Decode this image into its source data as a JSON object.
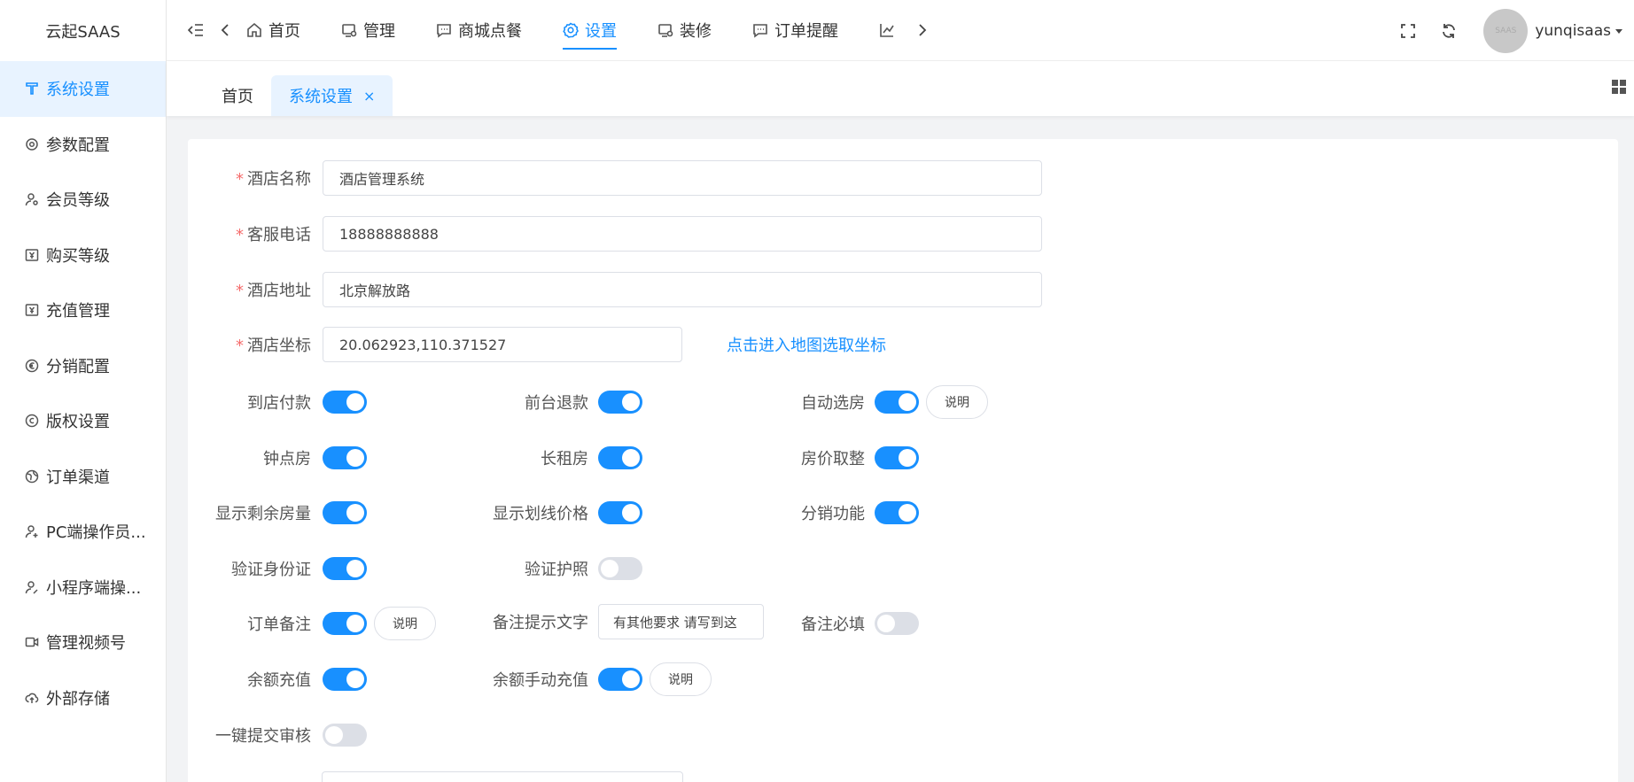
{
  "sidebar": {
    "brand": "云起SAAS",
    "items": [
      {
        "label": "系统设置",
        "icon": "tool-icon"
      },
      {
        "label": "参数配置",
        "icon": "gear-icon"
      },
      {
        "label": "会员等级",
        "icon": "user-icon"
      },
      {
        "label": "购买等级",
        "icon": "yen-icon"
      },
      {
        "label": "充值管理",
        "icon": "yen-icon"
      },
      {
        "label": "分销配置",
        "icon": "euro-icon"
      },
      {
        "label": "版权设置",
        "icon": "copyright-icon"
      },
      {
        "label": "订单渠道",
        "icon": "globe-icon"
      },
      {
        "label": "PC端操作员...",
        "icon": "user-add-icon"
      },
      {
        "label": "小程序端操...",
        "icon": "user-edit-icon"
      },
      {
        "label": "管理视频号",
        "icon": "video-icon"
      },
      {
        "label": "外部存储",
        "icon": "cloud-upload-icon"
      }
    ]
  },
  "header": {
    "nav": [
      {
        "label": "首页",
        "icon": "home-icon"
      },
      {
        "label": "管理",
        "icon": "monitor-gear-icon"
      },
      {
        "label": "商城点餐",
        "icon": "chat-icon"
      },
      {
        "label": "设置",
        "icon": "gear-icon"
      },
      {
        "label": "装修",
        "icon": "monitor-gear-icon"
      },
      {
        "label": "订单提醒",
        "icon": "chat-icon"
      }
    ],
    "username": "yunqisaas",
    "avatar_text": "SAAS"
  },
  "tabs": {
    "home": "首页",
    "active": "系统设置",
    "close": "×"
  },
  "form": {
    "hotel_name_label": "酒店名称",
    "hotel_name_value": "酒店管理系统",
    "phone_label": "客服电话",
    "phone_value": "18888888888",
    "address_label": "酒店地址",
    "address_value": "北京解放路",
    "coord_label": "酒店坐标",
    "coord_value": "20.062923,110.371527",
    "map_link": "点击进入地图选取坐标",
    "explain": "说明",
    "remark_tip_value": "有其他要求 请写到这",
    "toggles": {
      "pay_at_store": {
        "label": "到店付款",
        "on": true
      },
      "front_refund": {
        "label": "前台退款",
        "on": true
      },
      "auto_room": {
        "label": "自动选房",
        "on": true
      },
      "hourly_room": {
        "label": "钟点房",
        "on": true
      },
      "long_rent": {
        "label": "长租房",
        "on": true
      },
      "price_round": {
        "label": "房价取整",
        "on": true
      },
      "show_remaining": {
        "label": "显示剩余房量",
        "on": true
      },
      "show_strike_price": {
        "label": "显示划线价格",
        "on": true
      },
      "distribution": {
        "label": "分销功能",
        "on": true
      },
      "verify_id": {
        "label": "验证身份证",
        "on": true
      },
      "verify_passport": {
        "label": "验证护照",
        "on": false
      },
      "order_remark": {
        "label": "订单备注",
        "on": true
      },
      "remark_tip": {
        "label": "备注提示文字"
      },
      "remark_required": {
        "label": "备注必填",
        "on": false
      },
      "balance_recharge": {
        "label": "余额充值",
        "on": true
      },
      "manual_recharge": {
        "label": "余额手动充值",
        "on": true
      },
      "one_click_review": {
        "label": "一键提交审核",
        "on": false
      }
    }
  },
  "colors": {
    "accent": "#1890ff",
    "required": "#f56c6c"
  }
}
